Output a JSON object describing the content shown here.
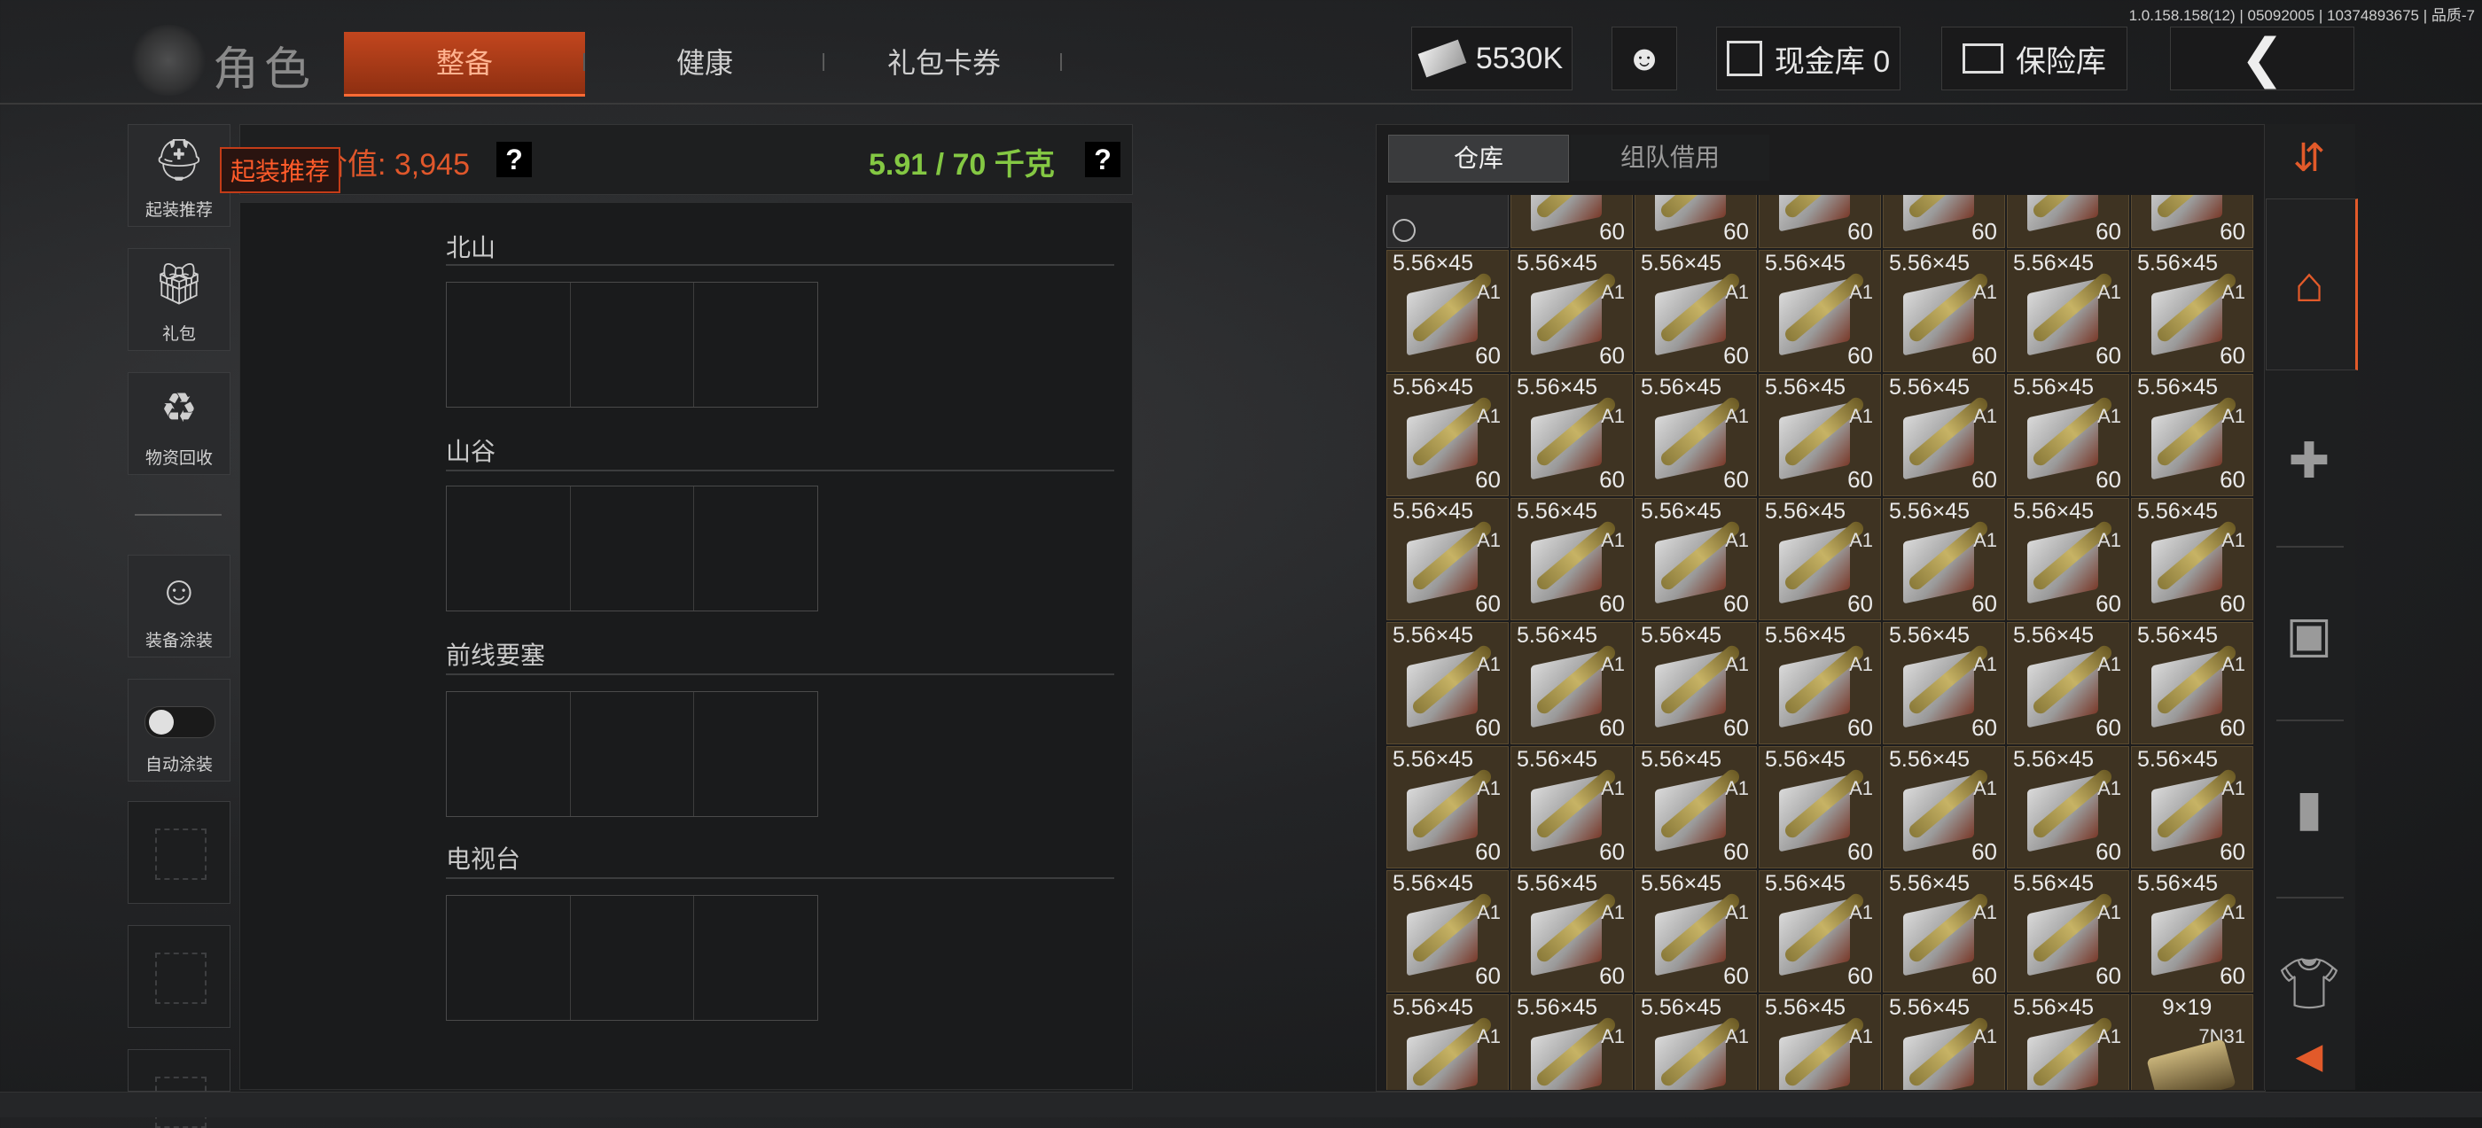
{
  "version": "1.0.158.158(12) | 05092005 | 10374893675 | 品质-7",
  "header": {
    "title": "角色",
    "tabs": [
      "整备",
      "健康",
      "礼包卡券"
    ],
    "money": "5530K",
    "cash_vault": "现金库 0",
    "safe": "保险库"
  },
  "sidebar": {
    "items": [
      {
        "label": "起装推荐"
      },
      {
        "label": "礼包"
      },
      {
        "label": "物资回收"
      },
      {
        "label": "装备涂装"
      },
      {
        "label": "自动涂装"
      }
    ]
  },
  "equip": {
    "value_label": "装备价值: 3,945",
    "weight": "5.91 / 70 千克",
    "help": "?",
    "tooltip": "起装推荐",
    "maps": [
      "北山",
      "山谷",
      "前线要塞",
      "电视台"
    ]
  },
  "warehouse": {
    "tabs": [
      "仓库",
      "组队借用"
    ],
    "partial_count": "60",
    "item_name": "5.56×45",
    "item_sub": "A1",
    "item_count": "60",
    "last_item_name": "9×19",
    "last_item_sub": "7N31"
  },
  "colors": {
    "accent": "#e0572b",
    "weight_green": "#84c843",
    "item_bg": "#3e3322"
  }
}
